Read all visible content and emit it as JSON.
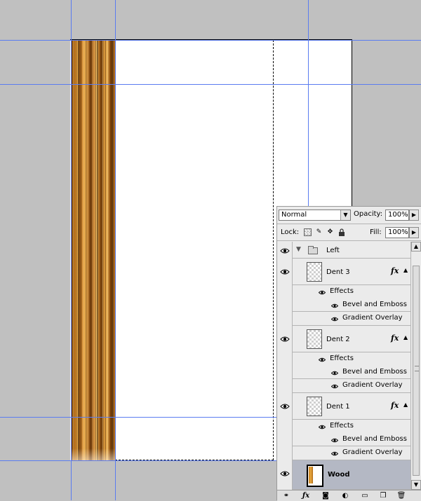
{
  "layers_panel": {
    "blend_mode": "Normal",
    "opacity_label": "Opacity:",
    "opacity_value": "100%",
    "lock_label": "Lock:",
    "fill_label": "Fill:",
    "fill_value": "100%",
    "group_name": "Left",
    "effects_label": "Effects",
    "effect_1": "Bevel and Emboss",
    "effect_2": "Gradient Overlay",
    "fx_label": "fx",
    "layers": [
      {
        "name": "Dent 3"
      },
      {
        "name": "Dent 2"
      },
      {
        "name": "Dent 1"
      },
      {
        "name": "Wood",
        "selected": true
      }
    ]
  },
  "icons": [
    "eye-icon",
    "folder-icon",
    "link-icon",
    "fx-icon",
    "mask-icon",
    "adjustment-icon",
    "new-group-icon",
    "new-layer-icon",
    "trash-icon",
    "lock-transparency-icon",
    "lock-brush-icon",
    "lock-move-icon",
    "lock-all-icon"
  ],
  "colors": {
    "guide": "#5a7cf0",
    "workspace": "#c0c0c0",
    "selected_row": "#b4b8c4",
    "wood": "#c8801e"
  }
}
